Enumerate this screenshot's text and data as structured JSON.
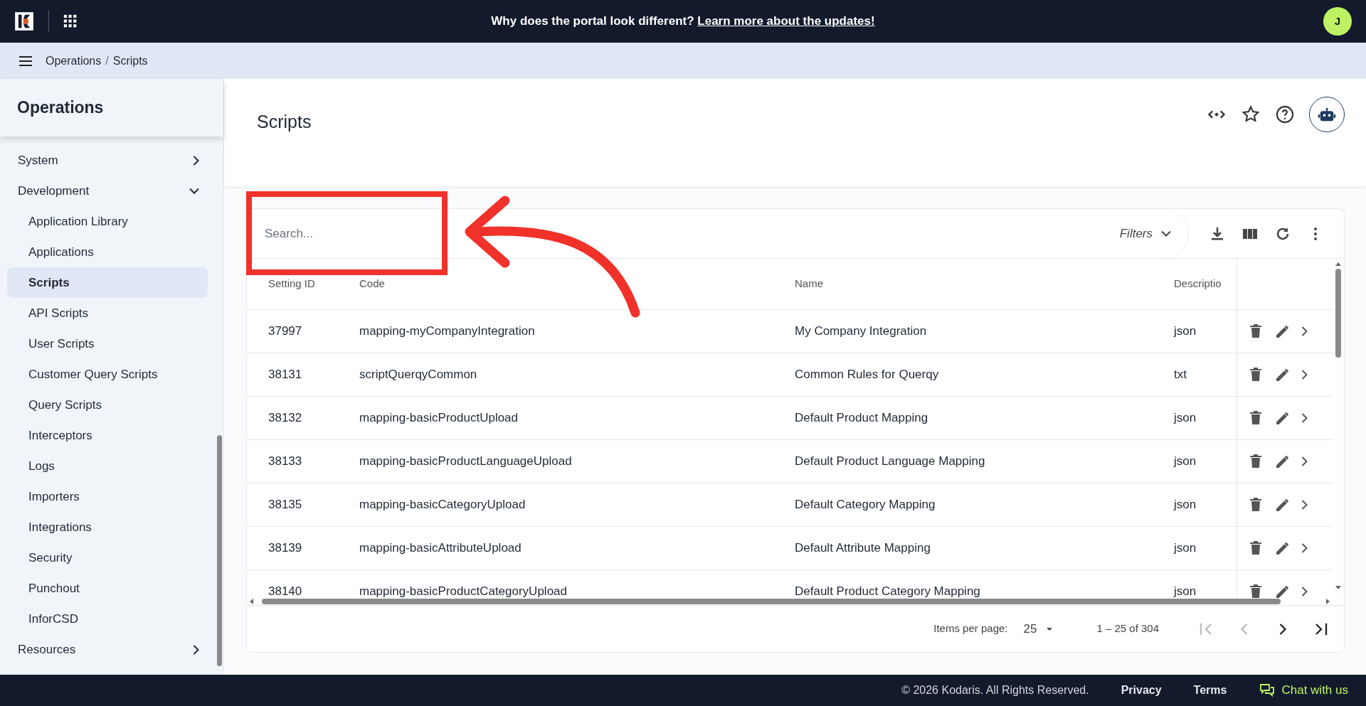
{
  "top_bar": {
    "announcement": "Why does the portal look different?",
    "announcement_link": "Learn more about the updates!",
    "avatar_initial": "J"
  },
  "breadcrumb": [
    "Operations",
    "Scripts"
  ],
  "breadcrumb_separator": "/",
  "sidebar": {
    "title": "Operations",
    "items": [
      {
        "label": "System",
        "expanded": false
      },
      {
        "label": "Development",
        "expanded": true,
        "children": [
          {
            "label": "Application Library",
            "selected": false
          },
          {
            "label": "Applications",
            "selected": false
          },
          {
            "label": "Scripts",
            "selected": true
          },
          {
            "label": "API Scripts",
            "selected": false
          },
          {
            "label": "User Scripts",
            "selected": false
          },
          {
            "label": "Customer Query Scripts",
            "selected": false
          },
          {
            "label": "Query Scripts",
            "selected": false
          },
          {
            "label": "Interceptors",
            "selected": false
          },
          {
            "label": "Logs",
            "selected": false
          },
          {
            "label": "Importers",
            "selected": false
          },
          {
            "label": "Integrations",
            "selected": false
          },
          {
            "label": "Security",
            "selected": false
          },
          {
            "label": "Punchout",
            "selected": false
          },
          {
            "label": "InforCSD",
            "selected": false
          }
        ]
      },
      {
        "label": "Resources",
        "expanded": false
      }
    ]
  },
  "page": {
    "title": "Scripts"
  },
  "table": {
    "search": {
      "placeholder": "Search..."
    },
    "filters_label": "Filters",
    "columns": [
      "Setting ID",
      "Code",
      "Name",
      "Descriptio"
    ],
    "rows": [
      [
        "37997",
        "mapping-myCompanyIntegration",
        "My Company Integration",
        "json"
      ],
      [
        "38131",
        "scriptQuerqyCommon",
        "Common Rules for Querqy",
        "txt"
      ],
      [
        "38132",
        "mapping-basicProductUpload",
        "Default Product Mapping",
        "json"
      ],
      [
        "38133",
        "mapping-basicProductLanguageUpload",
        "Default Product Language Mapping",
        "json"
      ],
      [
        "38135",
        "mapping-basicCategoryUpload",
        "Default Category Mapping",
        "json"
      ],
      [
        "38139",
        "mapping-basicAttributeUpload",
        "Default Attribute Mapping",
        "json"
      ],
      [
        "38140",
        "mapping-basicProductCategoryUpload",
        "Default Product Category Mapping",
        "json"
      ]
    ],
    "pagination": {
      "items_per_page_label": "Items per page:",
      "items_per_page": "25",
      "range": "1 – 25 of 304"
    }
  },
  "footer": {
    "copyright": "© 2026 Kodaris. All Rights Reserved.",
    "links": [
      "Privacy",
      "Terms"
    ],
    "chat": "Chat with us"
  }
}
